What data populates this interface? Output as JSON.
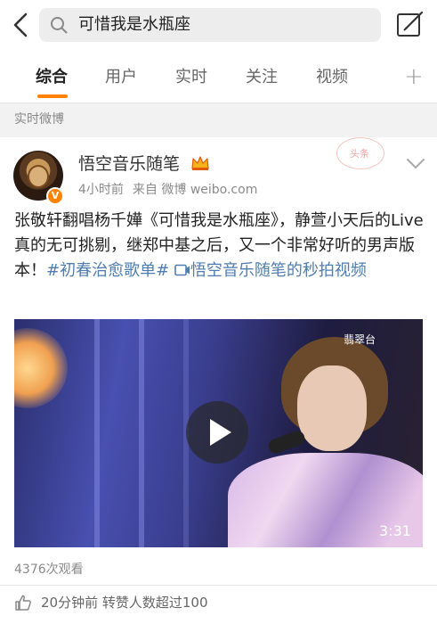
{
  "search": {
    "query": "可惜我是水瓶座"
  },
  "tabs": [
    {
      "label": "综合",
      "active": true
    },
    {
      "label": "用户",
      "active": false
    },
    {
      "label": "实时",
      "active": false
    },
    {
      "label": "关注",
      "active": false
    },
    {
      "label": "视频",
      "active": false
    }
  ],
  "colors": {
    "accent": "#ff8200",
    "link": "#507daf",
    "section_bg": "#f2f2f2"
  },
  "section": {
    "title": "实时微博"
  },
  "post": {
    "username": "悟空音乐随笔",
    "verified_badge": "V",
    "time": "4小时前",
    "source": "来自 微博 weibo.com",
    "stamp_text": "头条",
    "text_before": "张敬轩翻唱杨千嬅《可惜我是水瓶座》，静萱小天后的Live真的无可挑剔，继郑中基之后，又一个非常好听的男声版本！",
    "hashtag": "#初春治愈歌单#",
    "video_link": "悟空音乐随笔的秒拍视频",
    "video": {
      "channel_logo": "翡翠台",
      "duration": "3:31"
    },
    "views": "4376次观看",
    "like_info": "20分钟前 转赞人数超过100"
  },
  "icons": {
    "back": "chevron-left-icon",
    "search": "magnifier-icon",
    "edit": "compose-icon",
    "plus": "plus-icon",
    "crown": "crown-icon",
    "chevron": "chevron-down-icon",
    "play": "play-icon",
    "like": "thumbs-up-icon",
    "video_link": "video-link-icon"
  }
}
